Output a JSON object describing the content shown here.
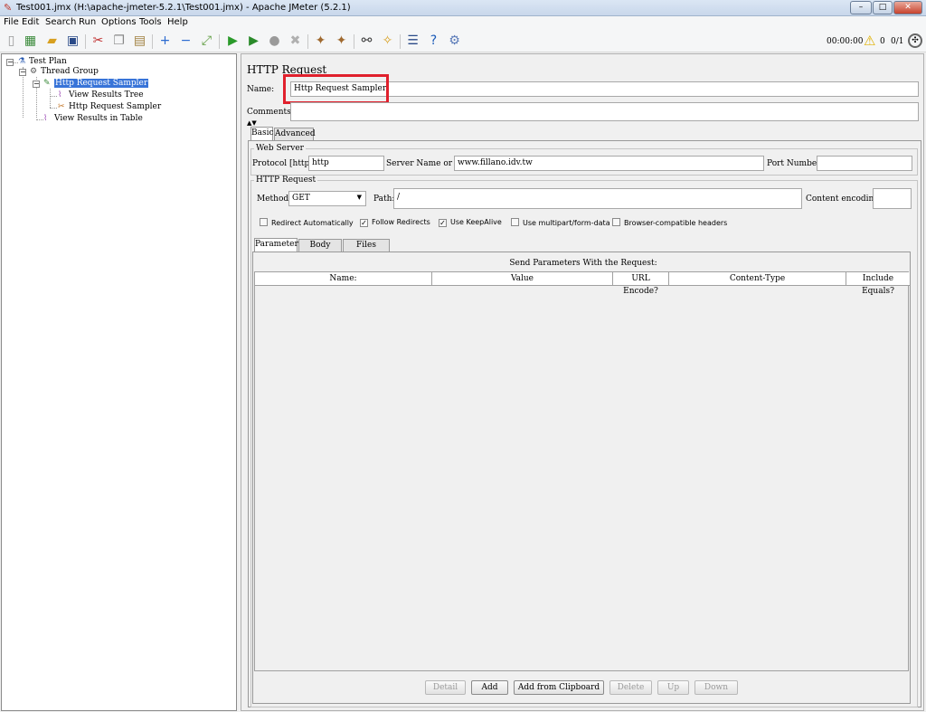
{
  "window": {
    "title": "Test001.jmx (H:\\apache-jmeter-5.2.1\\Test001.jmx) - Apache JMeter (5.2.1)"
  },
  "menu": [
    "File",
    "Edit",
    "Search",
    "Run",
    "Options",
    "Tools",
    "Help"
  ],
  "status": {
    "elapsed": "00:00:00",
    "warnings": "0",
    "threads": "0/1"
  },
  "tree": {
    "test_plan": "Test Plan",
    "thread_group": "Thread Group",
    "http_sampler": "Http Request Sampler",
    "view_results_tree": "View Results Tree",
    "http_sampler_child": "Http Request Sampler",
    "view_results_table": "View Results in Table"
  },
  "panel": {
    "heading": "HTTP Request",
    "name_label": "Name:",
    "name_value": "Http Request Sampler",
    "comments_label": "Comments:",
    "comments_value": "",
    "tabs": {
      "basic": "Basic",
      "advanced": "Advanced"
    },
    "web_server": {
      "title": "Web Server",
      "protocol_label": "Protocol [http]:",
      "protocol_value": "http",
      "server_label": "Server Name or IP:",
      "server_value": "www.fillano.idv.tw",
      "port_label": "Port Number:",
      "port_value": ""
    },
    "http_request": {
      "title": "HTTP Request",
      "method_label": "Method:",
      "method_value": "GET",
      "path_label": "Path:",
      "path_value": "/",
      "encoding_label": "Content encoding:",
      "encoding_value": ""
    },
    "options": {
      "redirect_auto": {
        "label": "Redirect Automatically",
        "checked": false
      },
      "follow_redirects": {
        "label": "Follow Redirects",
        "checked": true
      },
      "keepalive": {
        "label": "Use KeepAlive",
        "checked": true
      },
      "multipart": {
        "label": "Use multipart/form-data",
        "checked": false
      },
      "browser_headers": {
        "label": "Browser-compatible headers",
        "checked": false
      }
    },
    "param_tabs": {
      "parameters": "Parameters",
      "body": "Body Data",
      "files": "Files Upload"
    },
    "params_title": "Send Parameters With the Request:",
    "columns": [
      "Name:",
      "Value",
      "URL Encode?",
      "Content-Type",
      "Include Equals?"
    ],
    "buttons": {
      "detail": "Detail",
      "add": "Add",
      "clipboard": "Add from Clipboard",
      "delete": "Delete",
      "up": "Up",
      "down": "Down"
    }
  },
  "highlight_color": "#e0202c",
  "selection_color": "#3874d8"
}
